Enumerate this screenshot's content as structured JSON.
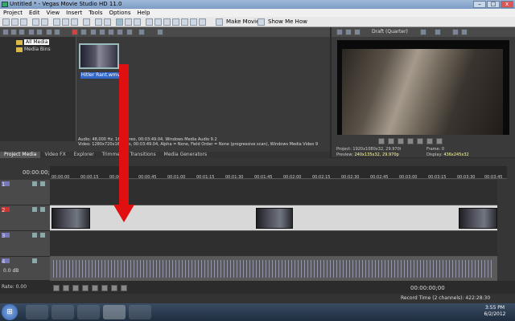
{
  "window": {
    "title": "Untitled * - Vegas Movie Studio HD 11.0",
    "min": "–",
    "max": "□",
    "close": "x"
  },
  "menu": [
    "Project",
    "Edit",
    "View",
    "Insert",
    "Tools",
    "Options",
    "Help"
  ],
  "toolbar": {
    "make_movie": "Make Movie",
    "show_me_how": "Show Me How"
  },
  "project_media": {
    "tree": [
      "All Media",
      "Media Bins"
    ],
    "clip_name": "Hitler Rant.wmv",
    "info_line1": "Audio: 48,000 Hz, 16 ... ereo, 00:03:49.04, Windows Media Audio 9.2",
    "info_line2": "Video: 1280x720x16 ... ps, 00:03:49.04, Alpha = None, Field Order = None (progressive scan), Windows Media Video 9",
    "tabs": [
      "Project Media",
      "Video FX",
      "Explorer",
      "Trimmer",
      "Transitions",
      "Media Generators"
    ]
  },
  "preview": {
    "quality": "Draft (Quarter)",
    "project_label": "Project:",
    "project_value": "1920x1080x32, 29.970i",
    "preview_label": "Preview:",
    "preview_value": "240x135x32, 29.970p",
    "frame_label": "Frame:",
    "frame_value": "0",
    "display_label": "Display:",
    "display_value": "436x245x32"
  },
  "timeline": {
    "timecode": "00:00:00;00",
    "ticks": [
      "00:00:00",
      "00:00:15",
      "00:00:30",
      "00:00:45",
      "00:01:00",
      "00:01:15",
      "00:01:30",
      "00:01:45",
      "00:02:00",
      "00:02:15",
      "00:02:30",
      "00:02:45",
      "00:03:00",
      "00:03:15",
      "00:03:30",
      "00:03:45"
    ],
    "tracks": [
      "1",
      "2",
      "3",
      "4"
    ],
    "audio_db": "0.0 dB",
    "rate": "Rate: 0.00",
    "end_time": "00:00:00;00"
  },
  "status": {
    "record_time": "Record Time (2 channels): 422:28:30"
  },
  "taskbar": {
    "time": "3:55 PM",
    "date": "6/2/2012",
    "start": "⊞"
  },
  "colors": {
    "arrow": "#e01010",
    "selection": "#3367c7"
  }
}
